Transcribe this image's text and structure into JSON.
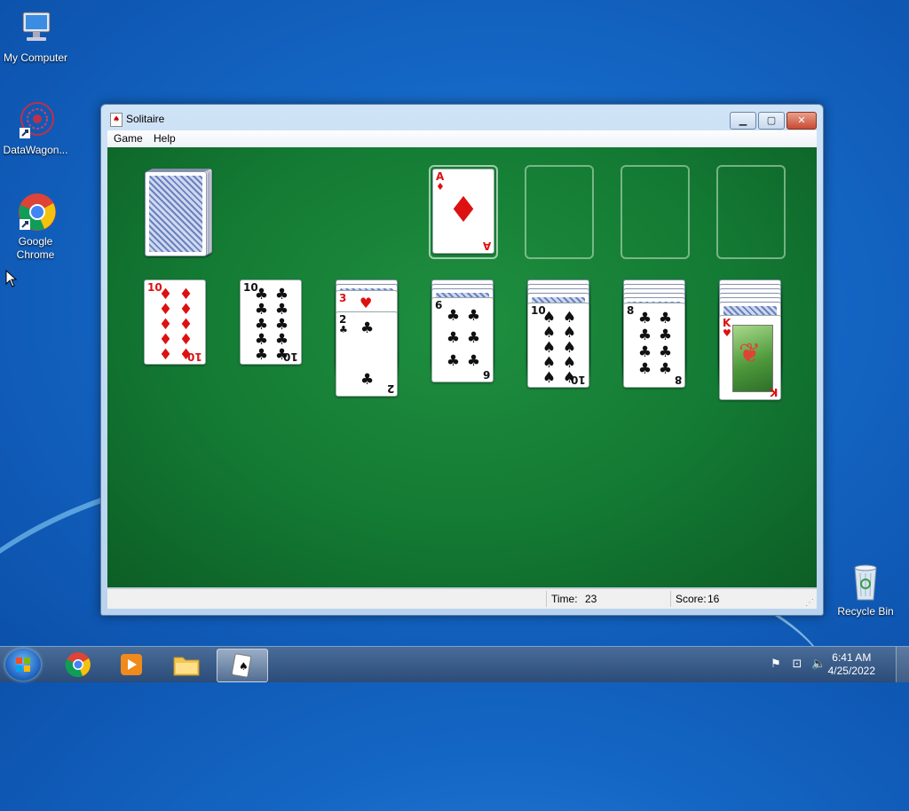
{
  "desktop": {
    "icons": [
      {
        "label": "My Computer",
        "icon": "computer-icon"
      },
      {
        "label": "DataWagon...",
        "icon": "datawagon-icon"
      },
      {
        "label": "Google Chrome",
        "icon": "chrome-icon"
      },
      {
        "label": "Recycle Bin",
        "icon": "recycle-bin-icon"
      }
    ]
  },
  "window": {
    "title": "Solitaire",
    "menu": [
      "Game",
      "Help"
    ],
    "controls": {
      "minimize": "▁",
      "maximize": "▢",
      "close": "✕"
    }
  },
  "game": {
    "stock": {
      "face_down": true
    },
    "foundations": [
      {
        "rank": "A",
        "suit": "♦",
        "color": "red"
      },
      {
        "empty": true
      },
      {
        "empty": true
      },
      {
        "empty": true
      }
    ],
    "tableau": [
      {
        "hidden": 0,
        "cards": [
          {
            "rank": "10",
            "suit": "♦",
            "color": "red"
          }
        ]
      },
      {
        "hidden": 0,
        "cards": [
          {
            "rank": "10",
            "suit": "♣",
            "color": "black"
          }
        ]
      },
      {
        "hidden": 2,
        "cards": [
          {
            "rank": "3",
            "suit": "♥",
            "color": "red"
          },
          {
            "rank": "2",
            "suit": "♣",
            "color": "black"
          }
        ]
      },
      {
        "hidden": 3,
        "cards": [
          {
            "rank": "6",
            "suit": "♣",
            "color": "black"
          }
        ]
      },
      {
        "hidden": 4,
        "cards": [
          {
            "rank": "10",
            "suit": "♠",
            "color": "black"
          }
        ]
      },
      {
        "hidden": 5,
        "cards": [
          {
            "rank": "8",
            "suit": "♣",
            "color": "black"
          }
        ]
      },
      {
        "hidden": 6,
        "cards": [
          {
            "rank": "K",
            "suit": "♥",
            "color": "red"
          }
        ]
      }
    ]
  },
  "status": {
    "time_label": "Time:",
    "time_value": "23",
    "score_label": "Score:",
    "score_value": "16"
  },
  "taskbar": {
    "clock_time": "6:41 AM",
    "clock_date": "4/25/2022"
  }
}
